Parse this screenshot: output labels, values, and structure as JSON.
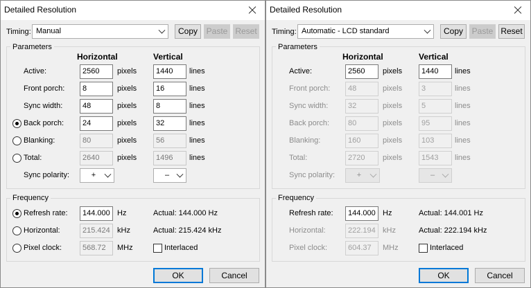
{
  "dialogs": [
    {
      "title": "Detailed Resolution",
      "timing_label": "Timing:",
      "timing_value": "Manual",
      "buttons": {
        "copy": "Copy",
        "paste": "Paste",
        "reset": "Reset"
      },
      "parameters_label": "Parameters",
      "col_horizontal": "Horizontal",
      "col_vertical": "Vertical",
      "rows": [
        {
          "label": "Active:",
          "h": "2560",
          "h_unit": "pixels",
          "v": "1440",
          "v_unit": "lines"
        },
        {
          "label": "Front porch:",
          "h": "8",
          "h_unit": "pixels",
          "v": "16",
          "v_unit": "lines"
        },
        {
          "label": "Sync width:",
          "h": "48",
          "h_unit": "pixels",
          "v": "8",
          "v_unit": "lines"
        },
        {
          "label": "Back porch:",
          "h": "24",
          "h_unit": "pixels",
          "v": "32",
          "v_unit": "lines"
        },
        {
          "label": "Blanking:",
          "h": "80",
          "h_unit": "pixels",
          "v": "56",
          "v_unit": "lines"
        },
        {
          "label": "Total:",
          "h": "2640",
          "h_unit": "pixels",
          "v": "1496",
          "v_unit": "lines"
        }
      ],
      "sync_polarity_label": "Sync polarity:",
      "sync_h": "+",
      "sync_v": "–",
      "frequency_label": "Frequency",
      "refresh_label": "Refresh rate:",
      "refresh_value": "144.000",
      "refresh_unit": "Hz",
      "refresh_actual": "Actual: 144.000 Hz",
      "horizontal_label": "Horizontal:",
      "horizontal_value": "215.424",
      "horizontal_unit": "kHz",
      "horizontal_actual": "Actual: 215.424 kHz",
      "pixel_clock_label": "Pixel clock:",
      "pixel_clock_value": "568.72",
      "pixel_clock_unit": "MHz",
      "interlaced_label": "Interlaced",
      "ok_label": "OK",
      "cancel_label": "Cancel"
    },
    {
      "title": "Detailed Resolution",
      "timing_label": "Timing:",
      "timing_value": "Automatic - LCD standard",
      "buttons": {
        "copy": "Copy",
        "paste": "Paste",
        "reset": "Reset"
      },
      "parameters_label": "Parameters",
      "col_horizontal": "Horizontal",
      "col_vertical": "Vertical",
      "rows": [
        {
          "label": "Active:",
          "h": "2560",
          "h_unit": "pixels",
          "v": "1440",
          "v_unit": "lines"
        },
        {
          "label": "Front porch:",
          "h": "48",
          "h_unit": "pixels",
          "v": "3",
          "v_unit": "lines"
        },
        {
          "label": "Sync width:",
          "h": "32",
          "h_unit": "pixels",
          "v": "5",
          "v_unit": "lines"
        },
        {
          "label": "Back porch:",
          "h": "80",
          "h_unit": "pixels",
          "v": "95",
          "v_unit": "lines"
        },
        {
          "label": "Blanking:",
          "h": "160",
          "h_unit": "pixels",
          "v": "103",
          "v_unit": "lines"
        },
        {
          "label": "Total:",
          "h": "2720",
          "h_unit": "pixels",
          "v": "1543",
          "v_unit": "lines"
        }
      ],
      "sync_polarity_label": "Sync polarity:",
      "sync_h": "+",
      "sync_v": "–",
      "frequency_label": "Frequency",
      "refresh_label": "Refresh rate:",
      "refresh_value": "144.000",
      "refresh_unit": "Hz",
      "refresh_actual": "Actual: 144.001 Hz",
      "horizontal_label": "Horizontal:",
      "horizontal_value": "222.194",
      "horizontal_unit": "kHz",
      "horizontal_actual": "Actual: 222.194 kHz",
      "pixel_clock_label": "Pixel clock:",
      "pixel_clock_value": "604.37",
      "pixel_clock_unit": "MHz",
      "interlaced_label": "Interlaced",
      "ok_label": "OK",
      "cancel_label": "Cancel"
    }
  ]
}
